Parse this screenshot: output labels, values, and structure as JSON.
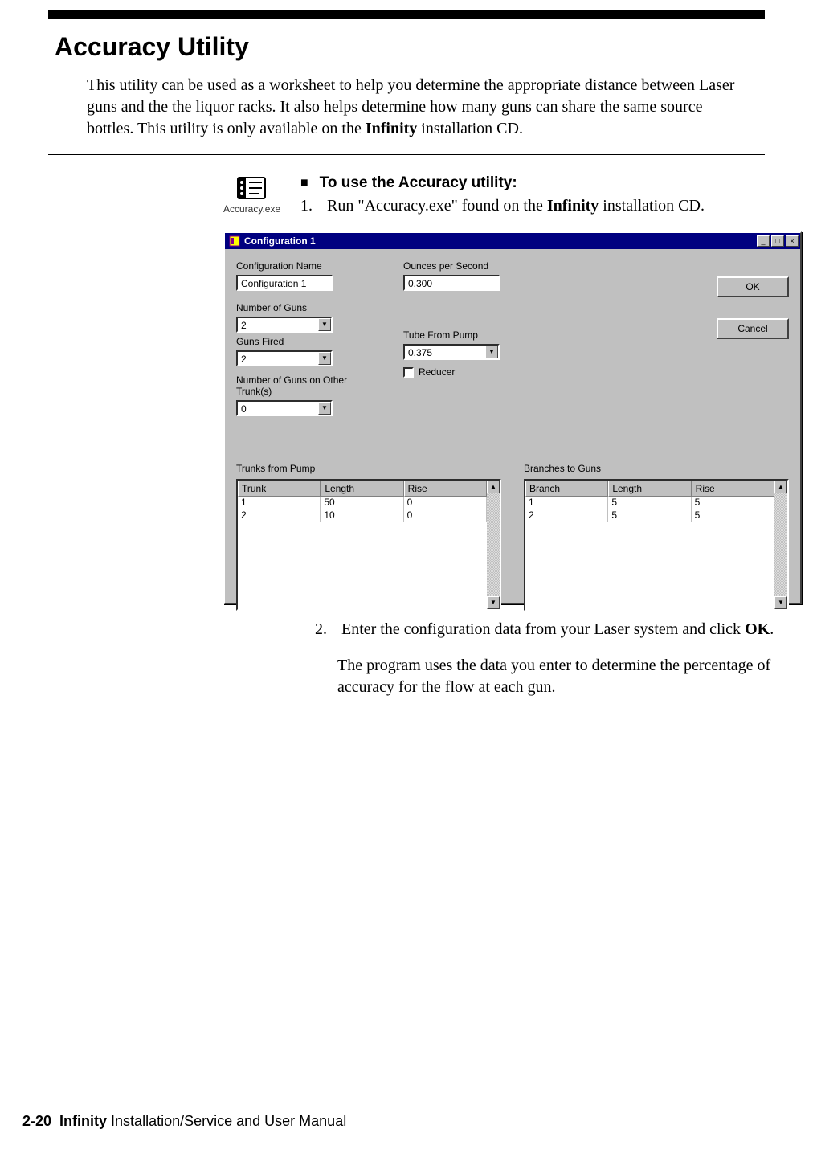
{
  "page": {
    "heading": "Accuracy Utility",
    "intro_pre": "This utility can be used as a worksheet to help you determine the appropriate distance between Laser guns and the the liquor racks. It also helps determine how many guns can share the same source bottles. This utility is only available on the ",
    "intro_bold": "Infinity",
    "intro_post": " installation CD.",
    "proc_header": "To use the Accuracy utility:",
    "step1_num": "1.",
    "step1_pre": "Run \"Accuracy.exe\" found on the ",
    "step1_bold": "Infinity",
    "step1_post": " installation CD.",
    "exe_label": "Accuracy.exe",
    "step2_num": "2.",
    "step2_pre": "Enter the configuration data from your Laser system and click ",
    "step2_bold": "OK",
    "step2_post": ".",
    "result_para": "The program uses the data you enter to determine the percentage of accuracy for the flow at each gun.",
    "footer_page": "2-20",
    "footer_bold": "Infinity",
    "footer_rest": " Installation/Service and User Manual"
  },
  "dialog": {
    "title": "Configuration 1",
    "labels": {
      "config_name": "Configuration Name",
      "num_guns": "Number of Guns",
      "guns_fired": "Guns Fired",
      "num_other": "Number of Guns on Other Trunk(s)",
      "oz_per_sec": "Ounces per Second",
      "tube_from_pump": "Tube From Pump",
      "reducer": "Reducer",
      "trunks_from_pump": "Trunks from Pump",
      "branches_to_guns": "Branches to Guns"
    },
    "values": {
      "config_name": "Configuration 1",
      "num_guns": "2",
      "guns_fired": "2",
      "num_other": "0",
      "oz_per_sec": "0.300",
      "tube_from_pump": "0.375"
    },
    "buttons": {
      "ok": "OK",
      "cancel": "Cancel"
    },
    "trunks": {
      "headers": [
        "Trunk",
        "Length",
        "Rise"
      ],
      "rows": [
        [
          "1",
          "50",
          "0"
        ],
        [
          "2",
          "10",
          "0"
        ]
      ]
    },
    "branches": {
      "headers": [
        "Branch",
        "Length",
        "Rise"
      ],
      "rows": [
        [
          "1",
          "5",
          "5"
        ],
        [
          "2",
          "5",
          "5"
        ]
      ]
    }
  }
}
